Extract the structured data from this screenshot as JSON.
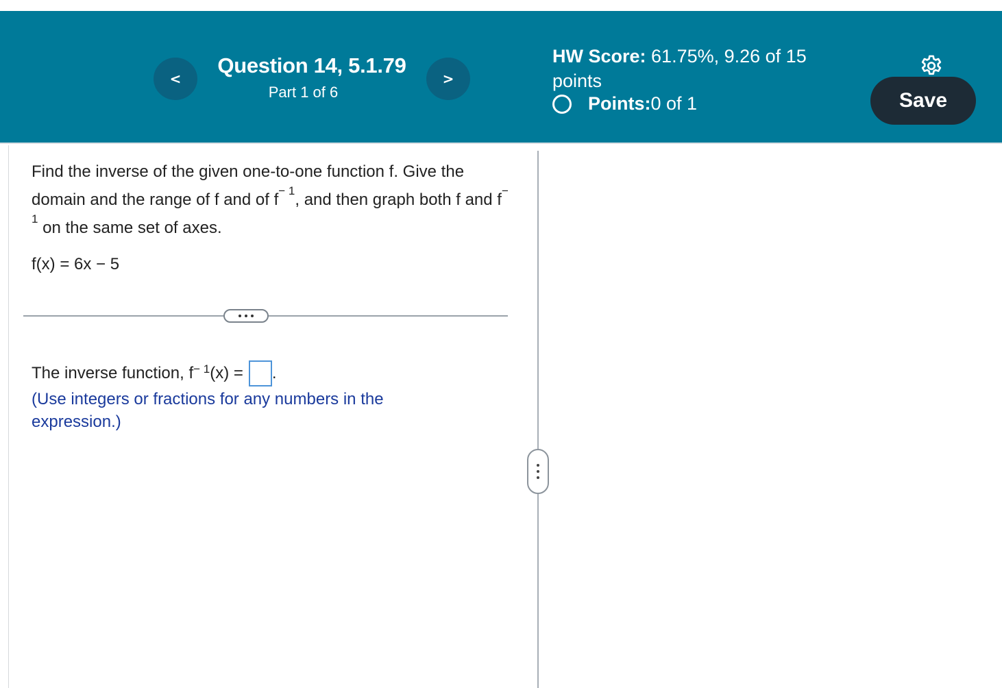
{
  "header": {
    "question_title": "Question 14, 5.1.79",
    "part": "Part 1 of 6",
    "prev_label": "<",
    "next_label": ">",
    "hw_score_label": "HW Score:",
    "hw_score_value": " 61.75%, 9.26 of 15",
    "hw_score_unit": "points",
    "points_label": "Points:",
    "points_value": " 0 of 1",
    "save_label": "Save",
    "settings_icon": "gear-icon"
  },
  "question": {
    "text_1": "Find the inverse of the given one-to-one function f. Give the domain and the range of f and of f",
    "sup_1": "− 1",
    "text_2": ", and then graph both f and f",
    "sup_2": "− 1",
    "text_3": " on the same set of axes.",
    "function": "f(x) = 6x − 5"
  },
  "answer": {
    "prefix": "The inverse function, f",
    "sup": "− 1",
    "suffix": "(x) =",
    "end": ".",
    "input_value": "",
    "hint": "(Use integers or fractions for any numbers in the expression.)"
  },
  "colors": {
    "header_bg": "#007a99",
    "nav_button": "#0a6281",
    "save_button": "#1d2b36",
    "hint_text": "#1a3a9c",
    "answer_box_border": "#4d94d9"
  }
}
